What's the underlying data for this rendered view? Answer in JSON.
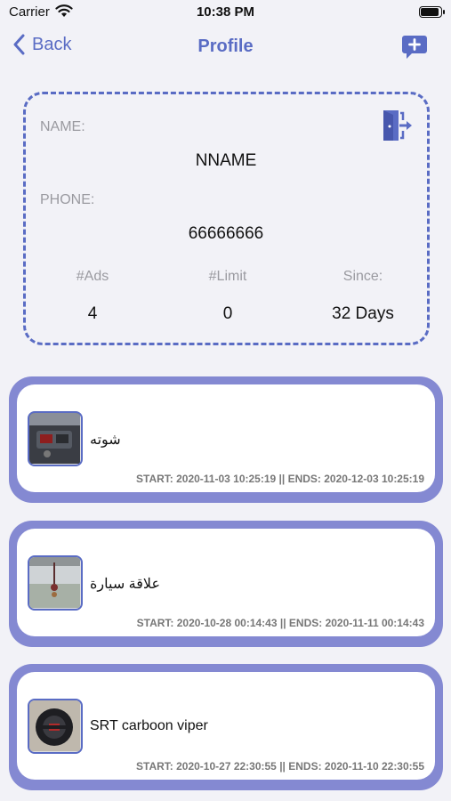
{
  "status_bar": {
    "carrier": "Carrier",
    "time": "10:38 PM"
  },
  "nav": {
    "back_label": "Back",
    "title": "Profile"
  },
  "profile": {
    "name_label": "NAME:",
    "name_value": "NNAME",
    "phone_label": "PHONE:",
    "phone_value": "66666666",
    "stats": [
      {
        "label": "#Ads",
        "value": "4"
      },
      {
        "label": "#Limit",
        "value": "0"
      },
      {
        "label": "Since:",
        "value": "32 Days"
      }
    ]
  },
  "ads": [
    {
      "title": "شوته",
      "dates": "START: 2020-11-03 10:25:19 || ENDS: 2020-12-03 10:25:19"
    },
    {
      "title": "علاقة سيارة",
      "dates": "START: 2020-10-28 00:14:43 || ENDS: 2020-11-11 00:14:43"
    },
    {
      "title": "SRT carboon viper",
      "dates": "START: 2020-10-27 22:30:55 || ENDS: 2020-11-10 22:30:55"
    }
  ],
  "colors": {
    "accent": "#5a6cc4",
    "card_border": "#8489d2",
    "label_gray": "#9a9aa0"
  }
}
